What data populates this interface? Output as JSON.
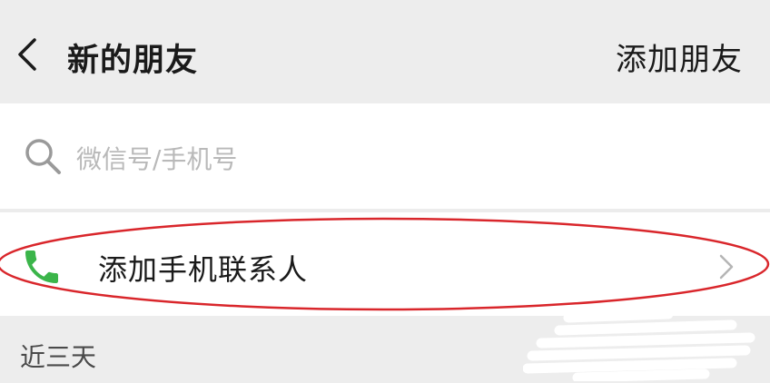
{
  "header": {
    "title": "新的朋友",
    "action_label": "添加朋友"
  },
  "search": {
    "placeholder": "微信号/手机号",
    "value": ""
  },
  "list": {
    "add_contacts_label": "添加手机联系人"
  },
  "section": {
    "recent_label": "近三天"
  },
  "colors": {
    "phone_icon": "#3bb54a",
    "annotation": "#d9262b",
    "background": "#ededed"
  },
  "icons": [
    "back-arrow-icon",
    "search-icon",
    "phone-icon",
    "chevron-right-icon"
  ]
}
